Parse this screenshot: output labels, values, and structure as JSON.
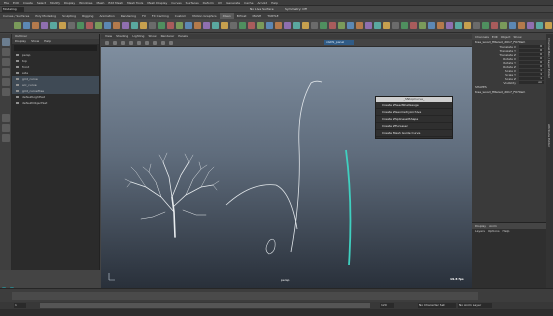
{
  "menubar": {
    "items": [
      "File",
      "Edit",
      "Create",
      "Select",
      "Modify",
      "Display",
      "Windows",
      "Mesh",
      "Edit Mesh",
      "Mesh Tools",
      "Mesh Display",
      "Curves",
      "Surfaces",
      "Deform",
      "UV",
      "Generate",
      "Cache",
      "Arnold",
      "Help"
    ]
  },
  "status_line": {
    "workspace": "Modeling",
    "no_live_surface": "No Live Surface",
    "symmetry": "Symmetry: Off"
  },
  "shelf_tabs": [
    "Curves / Surfaces",
    "Poly Modeling",
    "Sculpting",
    "Rigging",
    "Animation",
    "Rendering",
    "FX",
    "FX Caching",
    "Custom",
    "Motion Graphics",
    "XGen",
    "Bifrost",
    "MASH",
    "TURTLE"
  ],
  "active_shelf_tab": "XGen",
  "outliner": {
    "title": "Outliner",
    "menu": [
      "Display",
      "Show",
      "Help"
    ],
    "items": [
      {
        "label": "persp",
        "selected": false
      },
      {
        "label": "top",
        "selected": false
      },
      {
        "label": "front",
        "selected": false
      },
      {
        "label": "side",
        "selected": false
      },
      {
        "label": "grid_curve",
        "selected": true
      },
      {
        "label": "arc_curve",
        "selected": true
      },
      {
        "label": "grid_curveTree",
        "selected": true
      },
      {
        "label": "defaultLightSet",
        "selected": false
      },
      {
        "label": "defaultObjectSet",
        "selected": false
      }
    ]
  },
  "viewport": {
    "menu": [
      "View",
      "Shading",
      "Lighting",
      "Show",
      "Renderer",
      "Panels"
    ],
    "panel_name": "xGDS_panel",
    "camera_label": "persp",
    "fps": "19.8 fps"
  },
  "popup_menu": {
    "title": "_SNtopCurve_",
    "options": [
      "Create ZSeedShelGauge",
      "Create ZGeometryArchive",
      "Create ZSplinesetShape",
      "Create ZFurLaser",
      "Create Mesh Guide Curve"
    ]
  },
  "channel_box": {
    "tabs": [
      "Channels",
      "Edit",
      "Object",
      "Show"
    ],
    "object_name": "tree_wood_filtered_2017_F079sm",
    "attributes": [
      {
        "name": "Translate X",
        "value": "0"
      },
      {
        "name": "Translate Y",
        "value": "0"
      },
      {
        "name": "Translate Z",
        "value": "0"
      },
      {
        "name": "Rotate X",
        "value": "0"
      },
      {
        "name": "Rotate Y",
        "value": "0"
      },
      {
        "name": "Rotate Z",
        "value": "0"
      },
      {
        "name": "Scale X",
        "value": "1"
      },
      {
        "name": "Scale Y",
        "value": "1"
      },
      {
        "name": "Scale Z",
        "value": "1"
      },
      {
        "name": "Visibility",
        "value": "on"
      }
    ],
    "shapes_title": "SHAPES",
    "shape_name": "tree_wood_filtered_2017_F079sm"
  },
  "layer_editor": {
    "tabs": [
      "Display",
      "Anim"
    ],
    "menu": [
      "Layers",
      "Options",
      "Help"
    ]
  },
  "attr_side_tabs": [
    "Channel Box / Layer Editor",
    "Attribute Editor"
  ],
  "range": {
    "start": "1",
    "end": "120",
    "character_set": "No Character Set",
    "anim_layer": "No Anim Layer"
  },
  "colors": {
    "accent": "#19b8c4",
    "curve_highlight": "#3fd0c0",
    "selected_row": "#3f4a55"
  }
}
